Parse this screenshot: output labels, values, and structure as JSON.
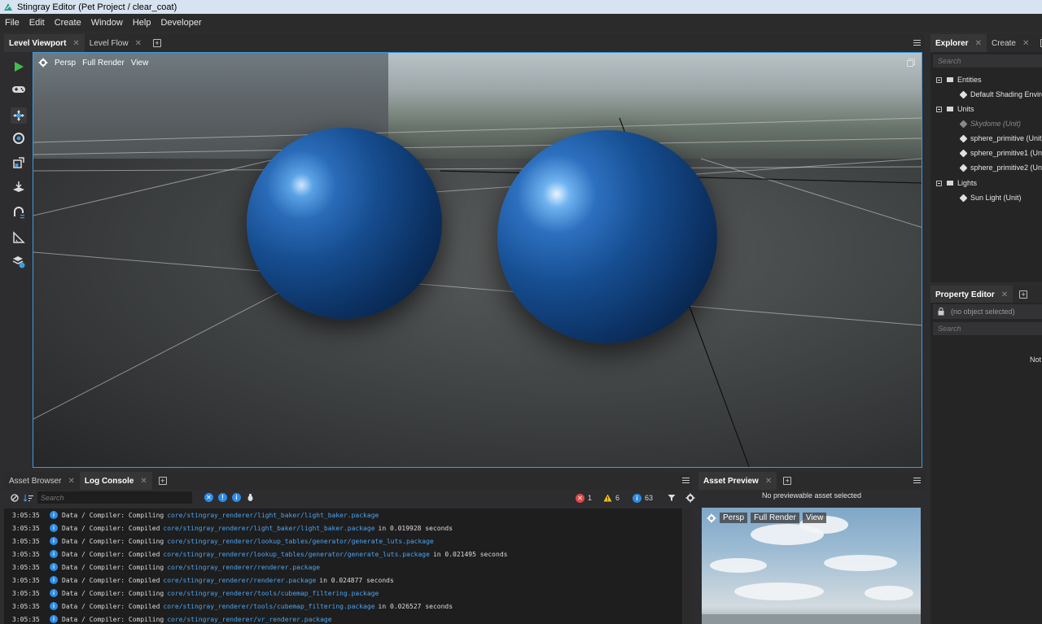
{
  "window": {
    "title": "Stingray Editor (Pet Project / clear_coat)"
  },
  "menu": [
    "File",
    "Edit",
    "Create",
    "Window",
    "Help",
    "Developer"
  ],
  "viewport_tabs": [
    {
      "label": "Level Viewport",
      "active": true
    },
    {
      "label": "Level Flow",
      "active": false
    }
  ],
  "viewport": {
    "camera": "Persp",
    "render_mode": "Full Render",
    "view_label": "View"
  },
  "tools": [
    "play-icon",
    "gamepad-icon",
    "move-icon",
    "rotate-icon",
    "scale-icon",
    "place-icon",
    "snap-icon",
    "ruler-icon",
    "units-icon"
  ],
  "explorer": {
    "tabs": [
      {
        "label": "Explorer",
        "active": true
      },
      {
        "label": "Create",
        "active": false
      }
    ],
    "search_placeholder": "Search",
    "tree": [
      {
        "label": "Entities",
        "type": "folder"
      },
      {
        "label": "Default Shading Enviro",
        "type": "entity"
      },
      {
        "label": "Units",
        "type": "folder"
      },
      {
        "label": "Skydome (Unit)",
        "type": "unit",
        "dim": true
      },
      {
        "label": "sphere_primitive (Unit)",
        "type": "unit"
      },
      {
        "label": "sphere_primitive1 (Uni",
        "type": "unit"
      },
      {
        "label": "sphere_primitive2 (Uni",
        "type": "unit"
      },
      {
        "label": "Lights",
        "type": "folder"
      },
      {
        "label": "Sun Light (Unit)",
        "type": "unit"
      }
    ]
  },
  "property_editor": {
    "tab": "Property Editor",
    "selection": "(no object selected)",
    "search_placeholder": "Search",
    "empty_text": "Not"
  },
  "bottom_tabs": [
    {
      "label": "Asset Browser",
      "active": false
    },
    {
      "label": "Log Console",
      "active": true
    }
  ],
  "log_console": {
    "search_placeholder": "Search",
    "counts": {
      "errors": "1",
      "warnings": "6",
      "info": "63"
    },
    "lines": [
      {
        "time": "3:05:35",
        "prefix": "Data / Compiler: Compiling",
        "path": "core/stingray_renderer/light_baker/light_baker.package",
        "suffix": ""
      },
      {
        "time": "3:05:35",
        "prefix": "Data / Compiler: Compiled",
        "path": "core/stingray_renderer/light_baker/light_baker.package",
        "suffix": "in 0.019928 seconds"
      },
      {
        "time": "3:05:35",
        "prefix": "Data / Compiler: Compiling",
        "path": "core/stingray_renderer/lookup_tables/generator/generate_luts.package",
        "suffix": ""
      },
      {
        "time": "3:05:35",
        "prefix": "Data / Compiler: Compiled",
        "path": "core/stingray_renderer/lookup_tables/generator/generate_luts.package",
        "suffix": "in 0.021495 seconds"
      },
      {
        "time": "3:05:35",
        "prefix": "Data / Compiler: Compiling",
        "path": "core/stingray_renderer/renderer.package",
        "suffix": ""
      },
      {
        "time": "3:05:35",
        "prefix": "Data / Compiler: Compiled",
        "path": "core/stingray_renderer/renderer.package",
        "suffix": "in 0.024877 seconds"
      },
      {
        "time": "3:05:35",
        "prefix": "Data / Compiler: Compiling",
        "path": "core/stingray_renderer/tools/cubemap_filtering.package",
        "suffix": ""
      },
      {
        "time": "3:05:35",
        "prefix": "Data / Compiler: Compiled",
        "path": "core/stingray_renderer/tools/cubemap_filtering.package",
        "suffix": "in 0.026527 seconds"
      },
      {
        "time": "3:05:35",
        "prefix": "Data / Compiler: Compiling",
        "path": "core/stingray_renderer/vr_renderer.package",
        "suffix": ""
      }
    ]
  },
  "asset_preview": {
    "tab": "Asset Preview",
    "message": "No previewable asset selected",
    "camera": "Persp",
    "render_mode": "Full Render",
    "view_label": "View"
  },
  "colors": {
    "accent": "#3e9be0",
    "info": "#2d8ce6",
    "error": "#e04848",
    "warning": "#f0c020",
    "link": "#4aa3f0"
  }
}
